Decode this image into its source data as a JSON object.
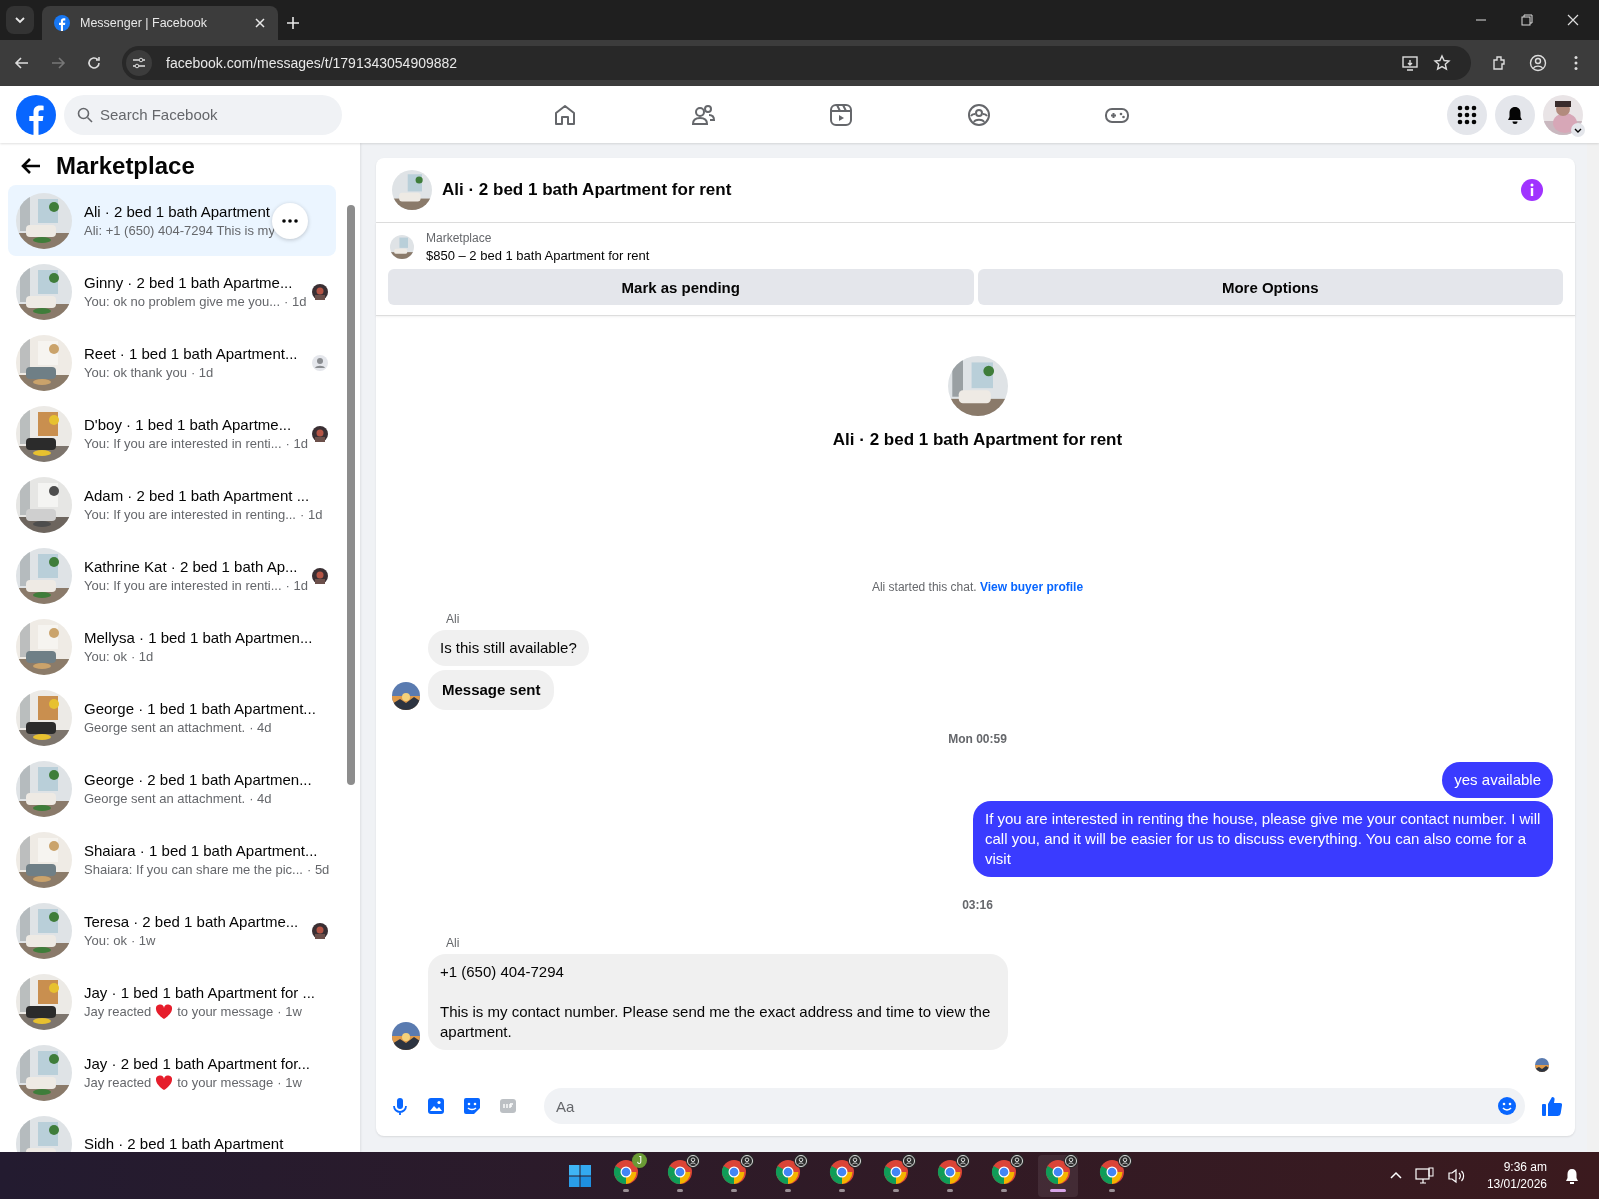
{
  "browser": {
    "tab_title": "Messenger | Facebook",
    "url": "facebook.com/messages/t/1791343054909882"
  },
  "header": {
    "search_placeholder": "Search Facebook",
    "nav": [
      {
        "kind": "home"
      },
      {
        "kind": "friends"
      },
      {
        "kind": "video"
      },
      {
        "kind": "groups"
      },
      {
        "kind": "gaming"
      }
    ]
  },
  "sidebar": {
    "title": "Marketplace",
    "conversations": [
      {
        "title": "Ali · 2 bed 1 bath Apartment",
        "preview": "Ali: +1 (650) 404-7294 This is my",
        "selected": true
      },
      {
        "title": "Ginny · 2 bed 1 bath Apartme...",
        "preview": "You: ok no problem give me you...",
        "time": "· 1d",
        "selected": false
      },
      {
        "title": "Reet · 1 bed 1 bath Apartment...",
        "preview": "You: ok thank you",
        "time": "· 1d",
        "seen": {
          "kind": "default"
        },
        "selected": false
      },
      {
        "title": "D'boy · 1 bed 1 bath Apartme...",
        "preview": "You: If you are interested in renti...",
        "time": "· 1d",
        "selected": false
      },
      {
        "title": "Adam · 2 bed 1 bath Apartment ...",
        "preview": "You: If you are interested in renting...",
        "time": "· 1d",
        "selected": false
      },
      {
        "title": "Kathrine Kat · 2 bed 1 bath Ap...",
        "preview": "You: If you are interested in renti...",
        "time": "· 1d",
        "selected": false
      },
      {
        "title": "Mellysa · 1 bed 1 bath Apartmen...",
        "preview": "You: ok",
        "time": "· 1d",
        "selected": false
      },
      {
        "title": "George · 1 bed 1 bath Apartment...",
        "preview": "George sent an attachment.",
        "time": "· 4d",
        "selected": false
      },
      {
        "title": "George · 2 bed 1 bath Apartmen...",
        "preview": "George sent an attachment.",
        "time": "· 4d",
        "selected": false
      },
      {
        "title": "Shaiara · 1 bed 1 bath Apartment...",
        "preview": "Shaiara: If you can share me the pic...",
        "time": "· 5d",
        "selected": false
      },
      {
        "title": "Teresa · 2 bed 1 bath Apartme...",
        "preview": "You: ok",
        "time": "· 1w",
        "selected": false
      },
      {
        "title": "Jay · 1 bed 1 bath Apartment for ...",
        "preview": "Jay reacted",
        "reaction": true,
        "preview_after": "to your message",
        "time": "· 1w",
        "selected": false
      },
      {
        "title": "Jay · 2 bed 1 bath Apartment for...",
        "preview": "Jay reacted",
        "reaction": true,
        "preview_after": "to your message",
        "time": "· 1w",
        "selected": false
      },
      {
        "title": "Sidh · 2 bed 1 bath Apartment",
        "selected": false
      }
    ]
  },
  "chat": {
    "title": "Ali · 2 bed 1 bath Apartment for rent",
    "listing": {
      "source": "Marketplace",
      "summary": "$850 – 2 bed 1 bath Apartment for rent",
      "buttons": [
        "Mark as pending",
        "More Options"
      ]
    },
    "intro_title": "Ali · 2 bed 1 bath Apartment for rent",
    "messages": [
      {
        "kind": "notice",
        "text": "Ali started this chat.",
        "link": "View buyer profile"
      },
      {
        "kind": "sender",
        "text": "Ali"
      },
      {
        "kind": "incoming",
        "text": "Is this still available?",
        "avatar": false,
        "emphasis": false
      },
      {
        "kind": "incoming",
        "text": "Message sent",
        "avatar": true,
        "emphasis": true
      },
      {
        "kind": "time",
        "text": "Mon 00:59"
      },
      {
        "kind": "outgoing",
        "text": "yes available"
      },
      {
        "kind": "outgoing",
        "text": "If you are interested in renting the house, please give me your contact number. I will call you, and it will be easier for us to discuss everything. You can also come for a visit"
      },
      {
        "kind": "time",
        "text": "03:16"
      },
      {
        "kind": "sender",
        "text": "Ali"
      },
      {
        "kind": "incoming",
        "text": "+1 (650) 404-7294\n\nThis is my contact number. Please send me the exact address and time to view the apartment.",
        "avatar": true,
        "emphasis": false
      },
      {
        "kind": "seen"
      }
    ],
    "composer_placeholder": "Aa"
  },
  "taskbar": {
    "apps": [
      {
        "badge": "J",
        "active": false
      },
      {
        "active": false
      },
      {
        "active": false
      },
      {
        "active": false
      },
      {
        "active": false
      },
      {
        "active": false
      },
      {
        "active": false
      },
      {
        "active": false
      },
      {
        "active": true
      },
      {
        "active": false
      }
    ],
    "time": "9:36 am",
    "date": "13/01/2026"
  }
}
